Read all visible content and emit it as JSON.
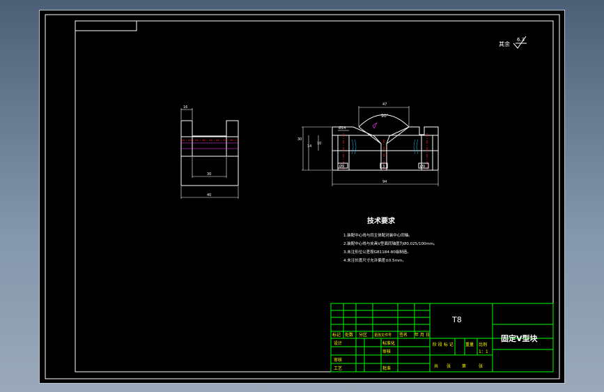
{
  "drawing": {
    "roughness_note": "其余",
    "roughness_value": "6.3",
    "side_view": {
      "top_width": "16",
      "inner_width": "30",
      "overall_width": "40"
    },
    "front_view": {
      "v_width": "47",
      "v_angle": "90°",
      "hole_dia": "Ø14",
      "height_total": "30",
      "height_mid": "14",
      "height_small": "10",
      "counterbore_left": "Ø9",
      "slot_width": "3",
      "counterbore_right": "Ø9",
      "overall_length": "94"
    },
    "tech_req": {
      "title": "技术要求",
      "items": [
        "1.装配中心线与同主体配对装中心同轴。",
        "2.装配中心线与夹具V型面同轴度为Ø0.025/100mm。",
        "3.未注形位公差按GB1184-80级制造。",
        "4.未注长度尺寸允许偏差±0.5mm。"
      ]
    }
  },
  "title_block": {
    "material": "T8",
    "part_name": "固定V型块",
    "row_labels": [
      "标记",
      "处数",
      "分区",
      "更改文件号",
      "签名",
      "年 月 日"
    ],
    "design": "设计",
    "standardization": "标准化",
    "review": "审核",
    "process": "工艺",
    "approve": "批准",
    "audit": "审核",
    "stage_header": [
      "阶 段 标 记",
      "重量",
      "比例"
    ],
    "scale": "1：1",
    "sheets": [
      "共",
      "张",
      "第",
      "张"
    ]
  }
}
